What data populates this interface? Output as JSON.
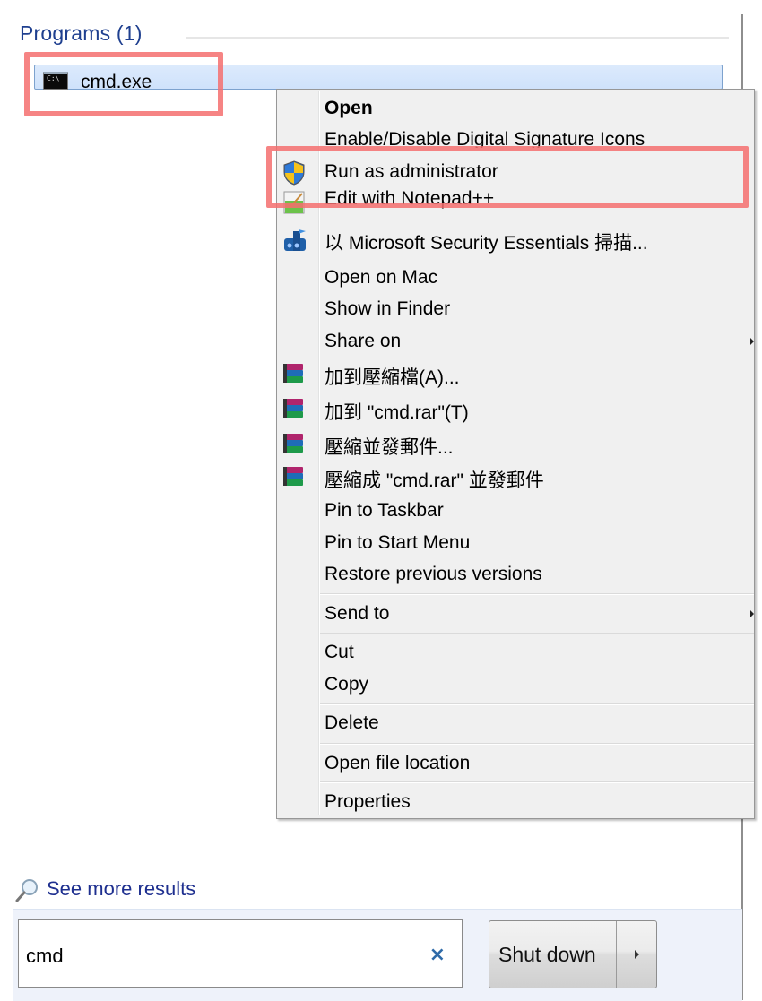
{
  "programs": {
    "header": "Programs (1)",
    "results": [
      {
        "label": "cmd.exe",
        "icon": "cmd-console-icon",
        "icon_text": "C:\\_"
      }
    ]
  },
  "context_menu": {
    "items": [
      {
        "label": "Open",
        "bold": true,
        "icon": null
      },
      {
        "label": "Enable/Disable Digital Signature Icons",
        "icon": null
      },
      {
        "label": "Run as administrator",
        "icon": "uac-shield-icon"
      },
      {
        "label": "Edit with Notepad++",
        "icon": "notepad-plus-plus-icon"
      },
      {
        "label": "以 Microsoft Security Essentials 掃描...",
        "icon": "security-essentials-icon"
      },
      {
        "label": "Open on Mac",
        "icon": null
      },
      {
        "label": "Show in Finder",
        "icon": null
      },
      {
        "label": "Share on",
        "icon": null,
        "submenu": true
      },
      {
        "label": "加到壓縮檔(A)...",
        "icon": "winrar-icon"
      },
      {
        "label": "加到 \"cmd.rar\"(T)",
        "icon": "winrar-icon"
      },
      {
        "label": "壓縮並發郵件...",
        "icon": "winrar-icon"
      },
      {
        "label": "壓縮成 \"cmd.rar\" 並發郵件",
        "icon": "winrar-icon"
      },
      {
        "label": "Pin to Taskbar",
        "icon": null
      },
      {
        "label": "Pin to Start Menu",
        "icon": null
      },
      {
        "label": "Restore previous versions",
        "icon": null
      },
      {
        "label": "Send to",
        "icon": null,
        "submenu": true
      },
      {
        "label": "Cut",
        "icon": null
      },
      {
        "label": "Copy",
        "icon": null
      },
      {
        "label": "Delete",
        "icon": null
      },
      {
        "label": "Open file location",
        "icon": null
      },
      {
        "label": "Properties",
        "icon": null
      }
    ]
  },
  "highlights": [
    "cmd.exe",
    "Run as administrator"
  ],
  "see_more": {
    "label": "See more results",
    "icon": "magnifier-icon"
  },
  "search": {
    "value": "cmd",
    "clear_icon": "×"
  },
  "shutdown": {
    "label": "Shut down",
    "arrow_icon": "triangle-right-icon"
  },
  "colors": {
    "header_text": "#1e3f8f",
    "link_text": "#1e2f8f",
    "selection_bg": "#d6e7fc",
    "menu_bg": "#f0f0f0",
    "highlight": "#f46e6e"
  }
}
